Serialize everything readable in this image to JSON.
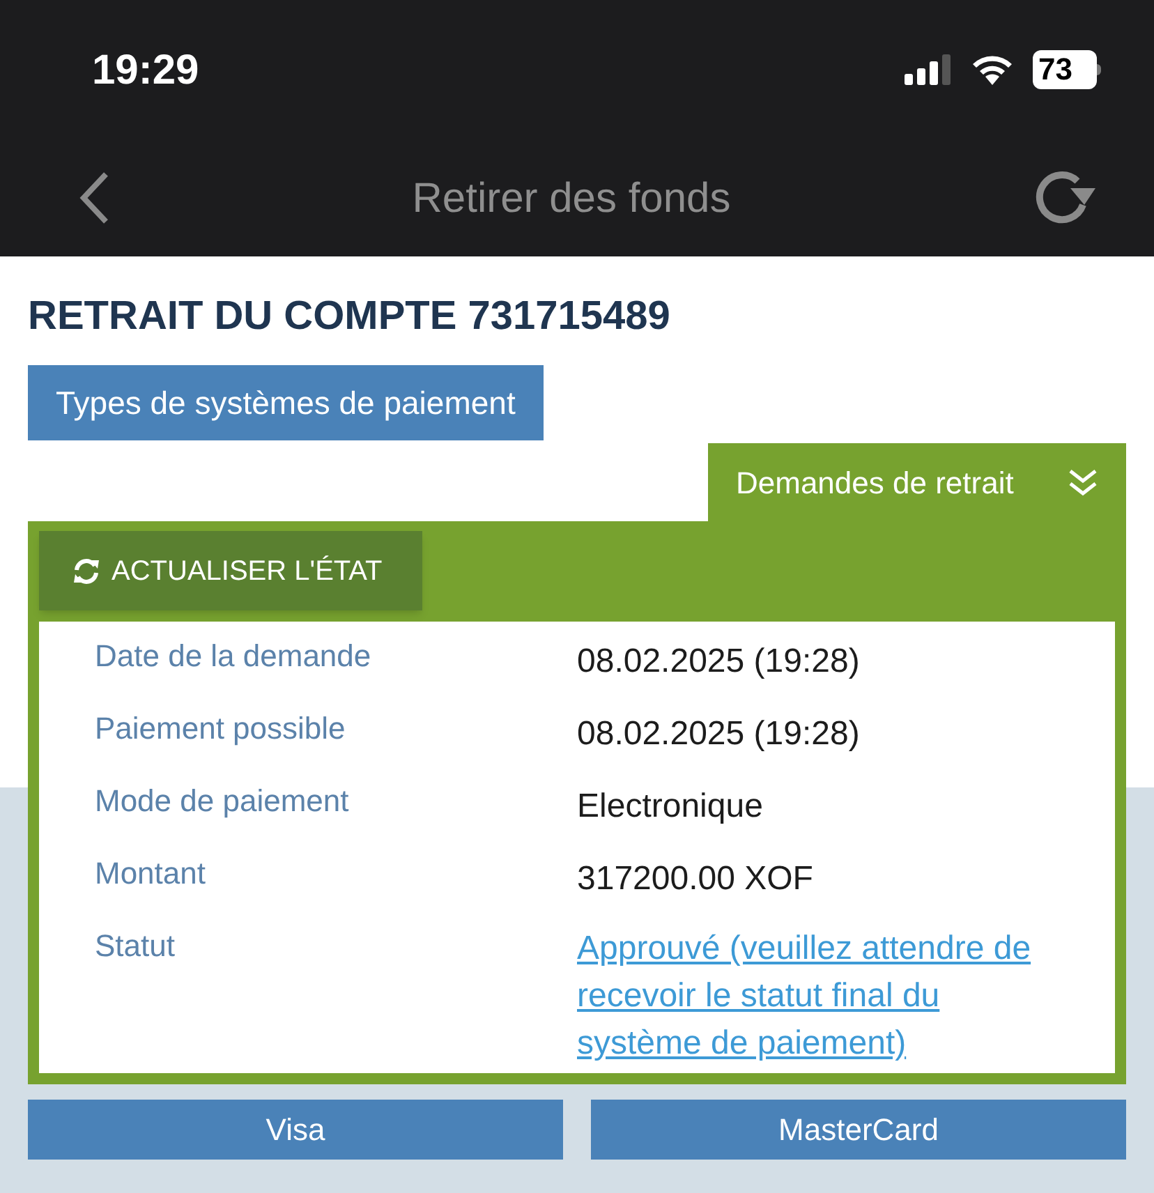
{
  "status_bar": {
    "time": "19:29",
    "battery": "73"
  },
  "nav": {
    "title": "Retirer des fonds"
  },
  "heading": "RETRAIT DU COMPTE 731715489",
  "payment_types_button": "Types de systèmes de paiement",
  "withdrawal_panel": {
    "tab": "Demandes de retrait",
    "expanded": true,
    "refresh_button": "ACTUALISER L'ÉTAT",
    "rows": [
      {
        "label": "Date de la demande",
        "value": "08.02.2025 (19:28)",
        "kind": "text"
      },
      {
        "label": "Paiement possible",
        "value": "08.02.2025 (19:28)",
        "kind": "text"
      },
      {
        "label": "Mode de paiement",
        "value": "Electronique",
        "kind": "text"
      },
      {
        "label": "Montant",
        "value": "317200.00 XOF",
        "kind": "text"
      },
      {
        "label": "Statut",
        "value": "Approuvé (veuillez attendre de recevoir le statut final du système de paiement)",
        "kind": "link"
      }
    ]
  },
  "payment_buttons": [
    "Visa",
    "MasterCard"
  ]
}
